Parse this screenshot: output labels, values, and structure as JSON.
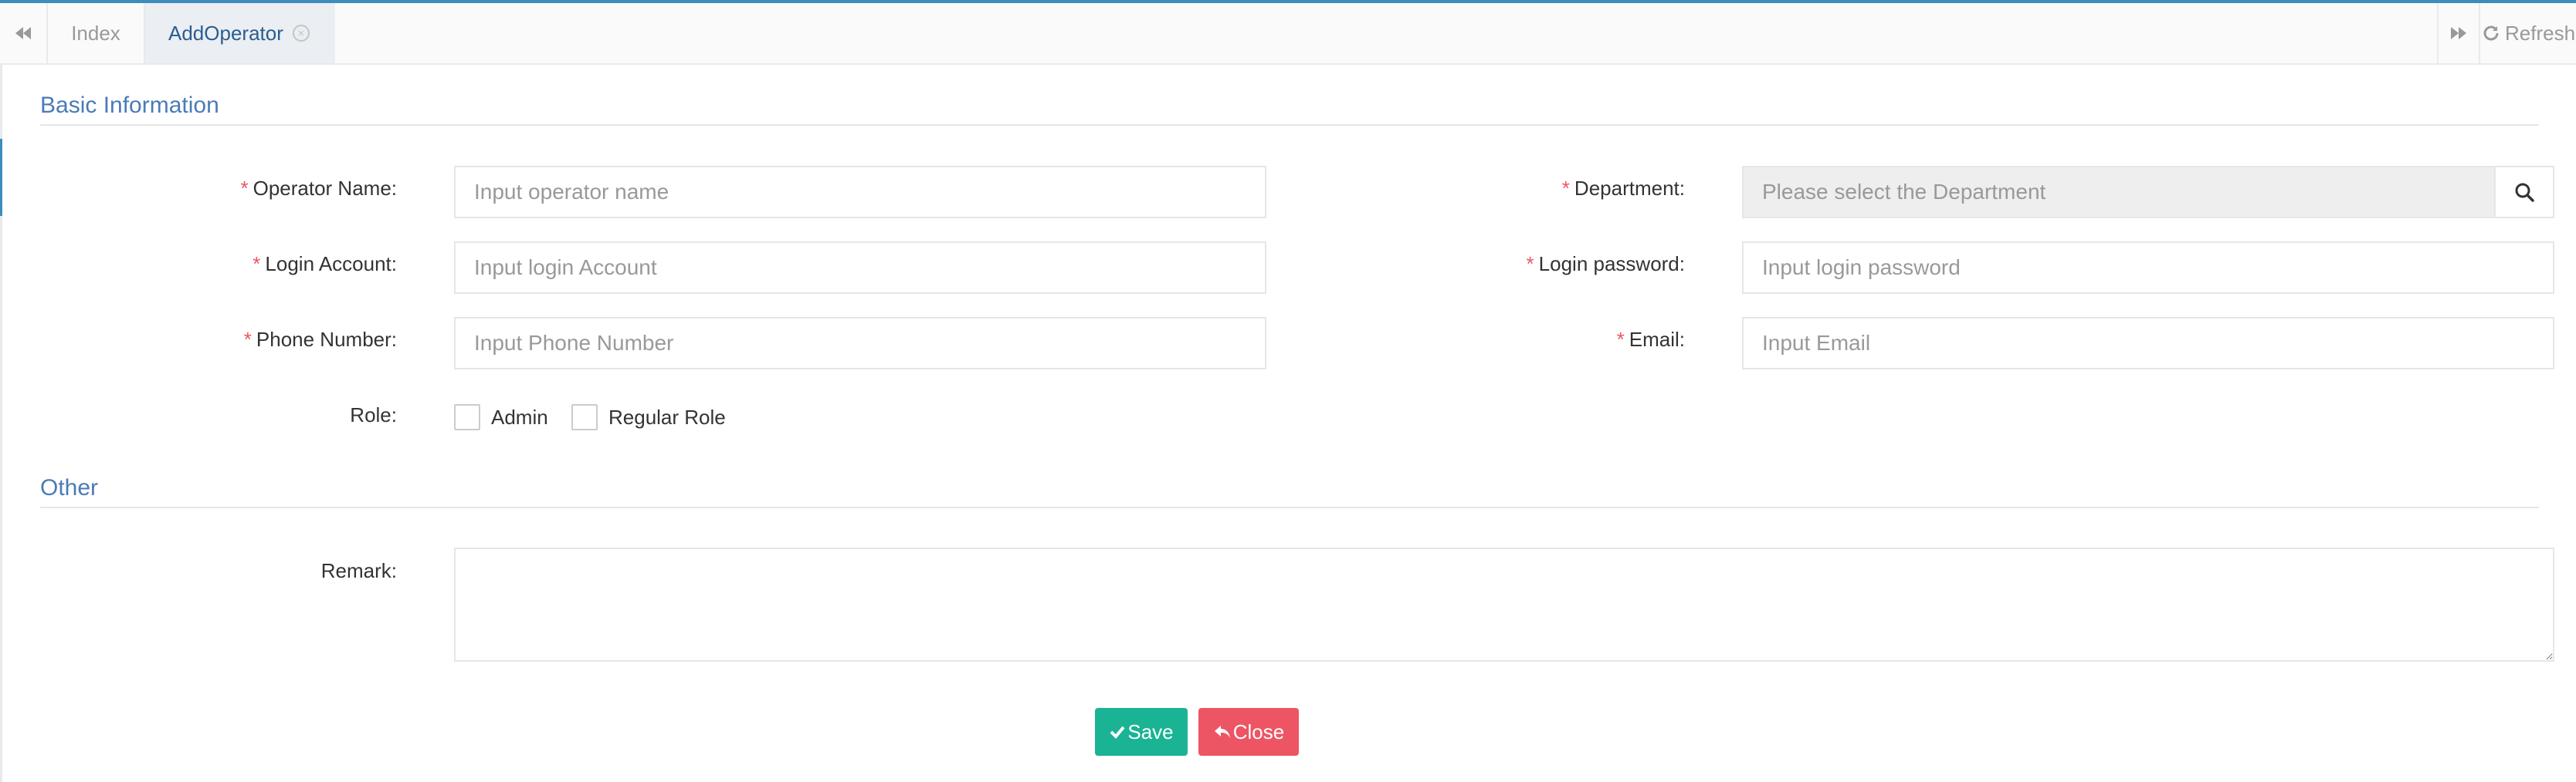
{
  "tabs": {
    "items": [
      {
        "label": "Index"
      },
      {
        "label": "AddOperator"
      }
    ],
    "refresh_label": "Refresh"
  },
  "sections": {
    "basic": "Basic Information",
    "other": "Other"
  },
  "form": {
    "operator_name": {
      "label": "Operator Name:",
      "placeholder": "Input operator name",
      "value": ""
    },
    "department": {
      "label": "Department:",
      "placeholder": "Please select the Department",
      "value": ""
    },
    "login_account": {
      "label": "Login Account:",
      "placeholder": "Input login Account",
      "value": ""
    },
    "login_password": {
      "label": "Login password:",
      "placeholder": "Input login password",
      "value": ""
    },
    "phone_number": {
      "label": "Phone Number:",
      "placeholder": "Input Phone Number",
      "value": ""
    },
    "email": {
      "label": "Email:",
      "placeholder": "Input Email",
      "value": ""
    },
    "role": {
      "label": "Role:",
      "options": [
        {
          "label": "Admin",
          "checked": false
        },
        {
          "label": "Regular Role",
          "checked": false
        }
      ]
    },
    "remark": {
      "label": "Remark:",
      "value": ""
    }
  },
  "required_marker": "*",
  "buttons": {
    "save_label": "Save",
    "close_label": "Close"
  },
  "colors": {
    "accent": "#3c8dbc",
    "section_title": "#4a7bb7",
    "required": "#ed5565",
    "save": "#1ab394",
    "close": "#ed5565"
  },
  "icons": {
    "nav_left": "double-chevron-left-icon",
    "tab_close": "circle-x-icon",
    "nav_right": "double-chevron-right-icon",
    "refresh": "refresh-icon",
    "department_search": "search-icon",
    "save": "check-icon",
    "close": "reply-icon"
  }
}
